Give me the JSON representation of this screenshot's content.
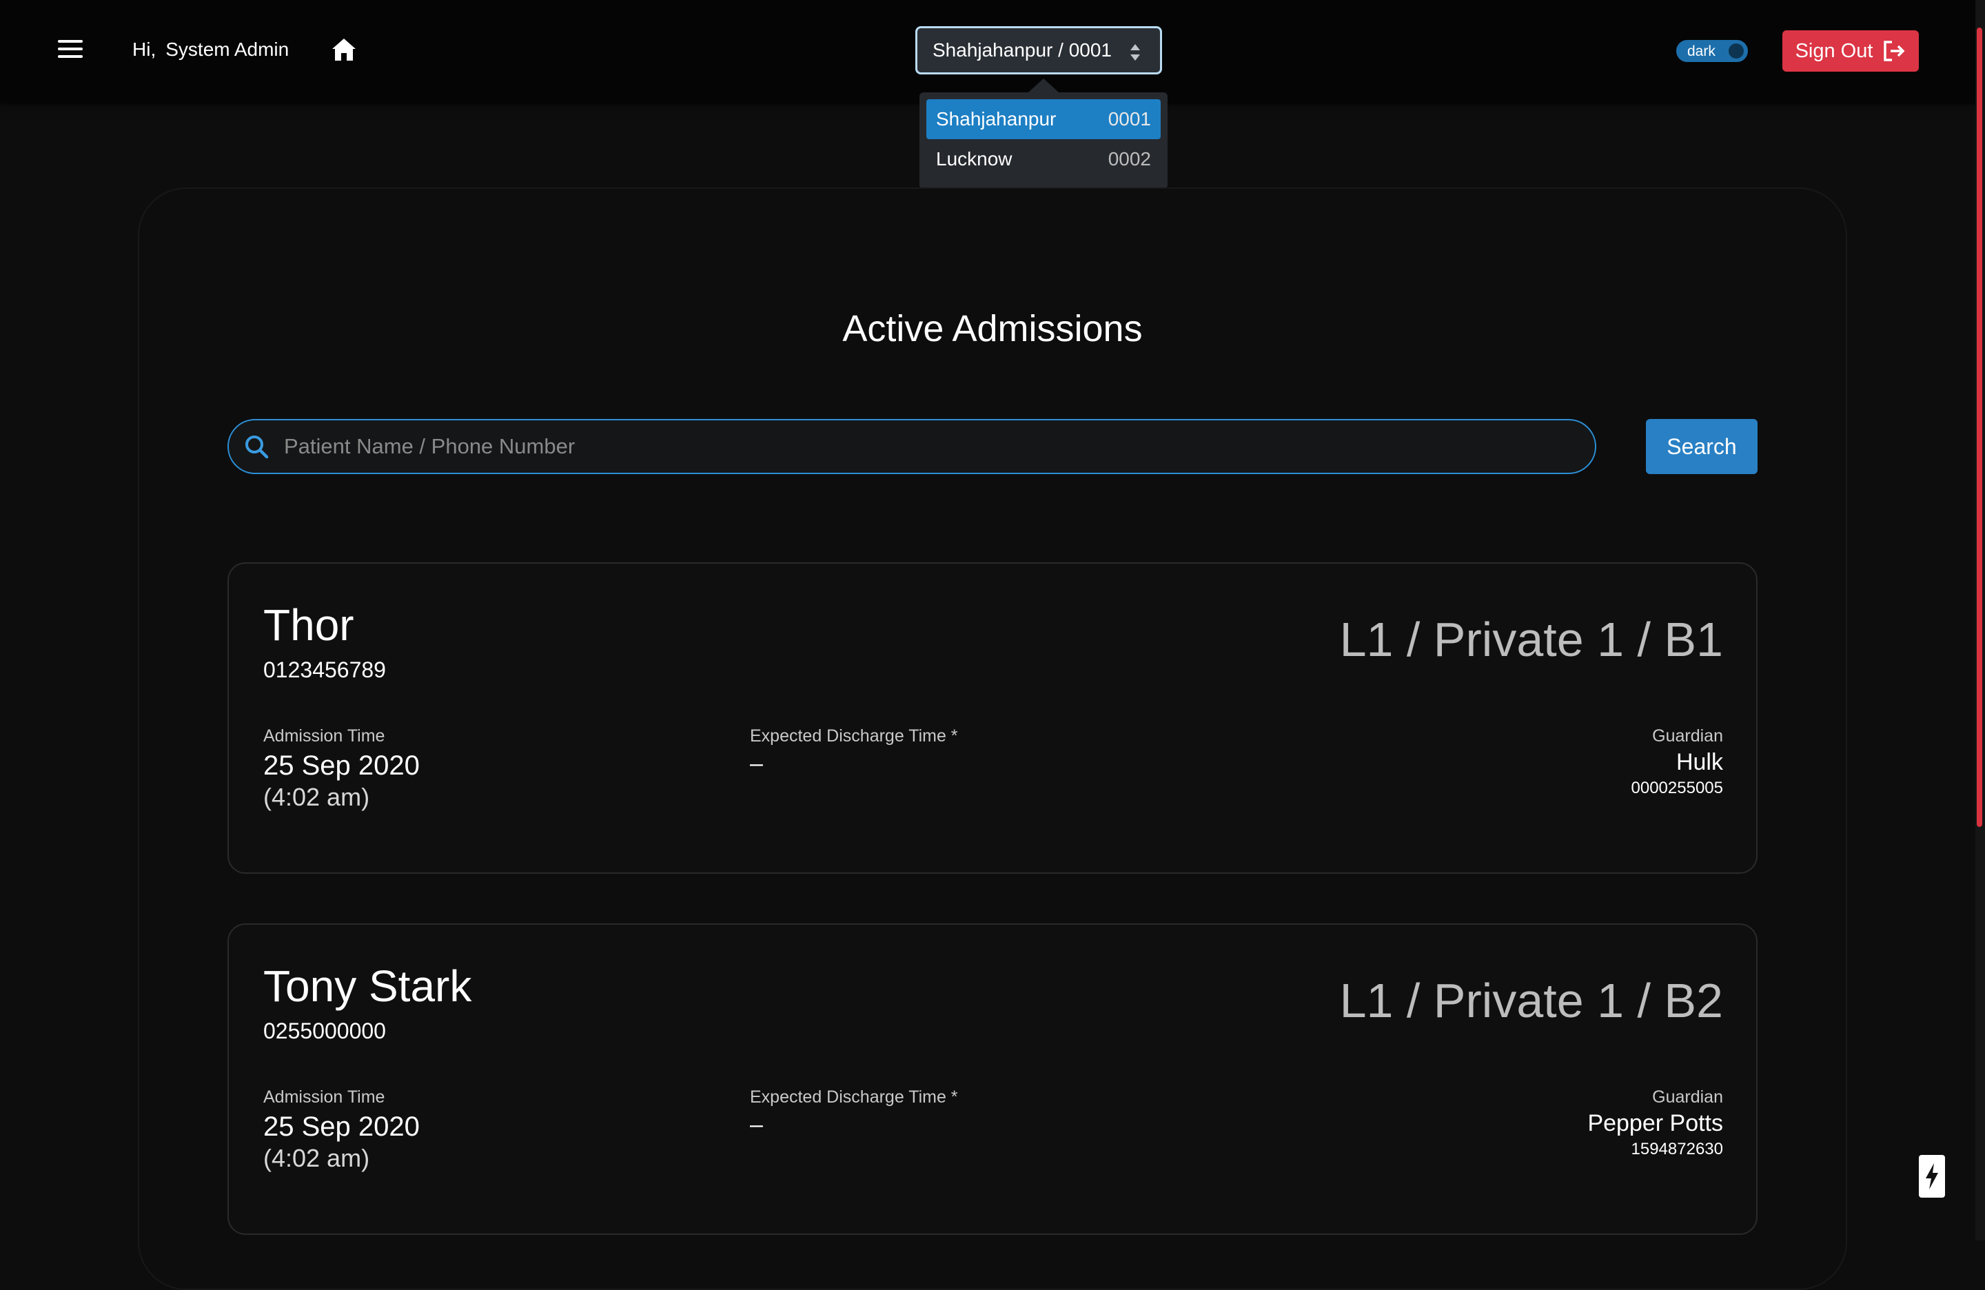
{
  "header": {
    "greeting": "Hi,",
    "user_name": "System Admin",
    "branch_selected": "Shahjahanpur / 0001",
    "theme_label": "dark",
    "signout_label": "Sign Out"
  },
  "branch_dropdown": {
    "options": [
      {
        "name": "Shahjahanpur",
        "code": "0001",
        "selected": true
      },
      {
        "name": "Lucknow",
        "code": "0002",
        "selected": false
      }
    ]
  },
  "page": {
    "title": "Active Admissions",
    "search_placeholder": "Patient Name / Phone Number",
    "search_label": "Search"
  },
  "labels": {
    "admission_time": "Admission Time",
    "expected_discharge": "Expected Discharge Time *",
    "guardian": "Guardian"
  },
  "admissions": [
    {
      "name": "Thor",
      "phone": "0123456789",
      "bed": "L1 / Private 1 / B1",
      "admission_date": "25 Sep 2020",
      "admission_time": "(4:02 am)",
      "expected_discharge": "–",
      "guardian_name": "Hulk",
      "guardian_phone": "0000255005"
    },
    {
      "name": "Tony Stark",
      "phone": "0255000000",
      "bed": "L1 / Private 1 / B2",
      "admission_date": "25 Sep 2020",
      "admission_time": "(4:02 am)",
      "expected_discharge": "–",
      "guardian_name": "Pepper Potts",
      "guardian_phone": "1594872630"
    }
  ],
  "colors": {
    "accent": "#2980c4",
    "danger": "#dc3545",
    "background": "#0d0d0e"
  },
  "icons": [
    "menu-icon",
    "home-icon",
    "sort-caret-icon",
    "sign-out-icon",
    "search-icon",
    "bolt-icon"
  ]
}
